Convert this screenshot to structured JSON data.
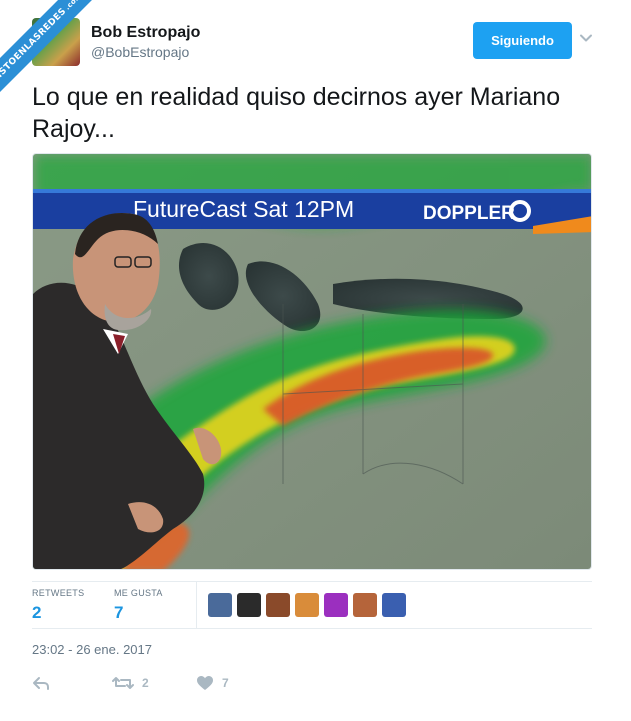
{
  "watermark": {
    "text": "VISTOENLASREDES",
    "suffix": ".com"
  },
  "user": {
    "name": "Bob Estropajo",
    "handle": "@BobEstropajo"
  },
  "follow_button": {
    "label": "Siguiendo"
  },
  "tweet": {
    "text": "Lo que en realidad quiso decirnos ayer Mariano Rajoy...",
    "timestamp": "23:02 - 26 ene. 2017"
  },
  "media": {
    "banner_text": "FutureCast  Sat 12PM",
    "logo_text": "DOPPLER"
  },
  "stats": {
    "retweets_label": "RETWEETS",
    "retweets_value": "2",
    "likes_label": "ME GUSTA",
    "likes_value": "7"
  },
  "likers": [
    {
      "color": "#4a6a9a"
    },
    {
      "color": "#2b2b2b"
    },
    {
      "color": "#8a4a2a"
    },
    {
      "color": "#d98c3a"
    },
    {
      "color": "#9b2fbf"
    },
    {
      "color": "#b5643a"
    },
    {
      "color": "#3a5fb0"
    }
  ],
  "actions": {
    "reply_icon": "reply-icon",
    "retweet_count": "2",
    "like_count": "7"
  },
  "colors": {
    "accent": "#1da1f2",
    "link": "#1b95e0",
    "muted": "#657786",
    "icon": "#aab8c2"
  }
}
